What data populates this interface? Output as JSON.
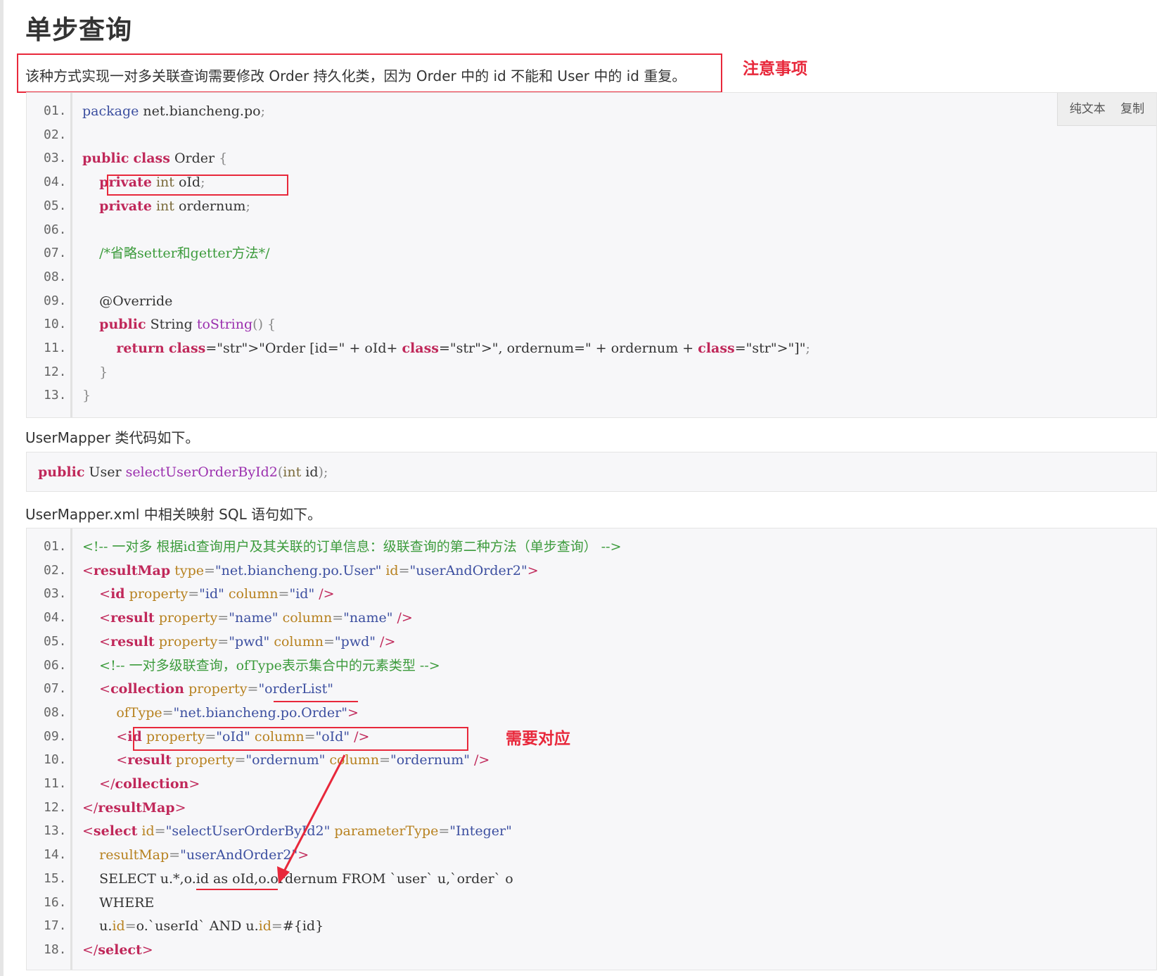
{
  "title": "单步查询",
  "note": {
    "text": "该种方式实现一对多关联查询需要修改 Order 持久化类，因为 Order 中的 id 不能和 User 中的 id 重复。",
    "label": "注意事项"
  },
  "toolbar": {
    "plain_text": "纯文本",
    "copy": "复制"
  },
  "code1": {
    "lines": [
      {
        "n": "01.",
        "t": "package net.biancheng.po;"
      },
      {
        "n": "02.",
        "t": ""
      },
      {
        "n": "03.",
        "t": "public class Order {"
      },
      {
        "n": "04.",
        "t": "    private int oId;"
      },
      {
        "n": "05.",
        "t": "    private int ordernum;"
      },
      {
        "n": "06.",
        "t": ""
      },
      {
        "n": "07.",
        "t": "    /*省略setter和getter方法*/"
      },
      {
        "n": "08.",
        "t": ""
      },
      {
        "n": "09.",
        "t": "    @Override"
      },
      {
        "n": "10.",
        "t": "    public String toString() {"
      },
      {
        "n": "11.",
        "t": "        return \"Order [id=\" + oId+ \", ordernum=\" + ordernum + \"]\";"
      },
      {
        "n": "12.",
        "t": "    }"
      },
      {
        "n": "13.",
        "t": "}"
      }
    ]
  },
  "para1": "UserMapper 类代码如下。",
  "code2": {
    "line": "public User selectUserOrderById2(int id);"
  },
  "para2": "UserMapper.xml 中相关映射 SQL 语句如下。",
  "code3": {
    "lines": [
      {
        "n": "01.",
        "t": "<!-- 一对多 根据id查询用户及其关联的订单信息：级联查询的第二种方法（单步查询） -->"
      },
      {
        "n": "02.",
        "t": "<resultMap type=\"net.biancheng.po.User\" id=\"userAndOrder2\">"
      },
      {
        "n": "03.",
        "t": "    <id property=\"id\" column=\"id\" />"
      },
      {
        "n": "04.",
        "t": "    <result property=\"name\" column=\"name\" />"
      },
      {
        "n": "05.",
        "t": "    <result property=\"pwd\" column=\"pwd\" />"
      },
      {
        "n": "06.",
        "t": "    <!-- 一对多级联查询，ofType表示集合中的元素类型 -->"
      },
      {
        "n": "07.",
        "t": "    <collection property=\"orderList\""
      },
      {
        "n": "08.",
        "t": "        ofType=\"net.biancheng.po.Order\">"
      },
      {
        "n": "09.",
        "t": "        <id property=\"oId\" column=\"oId\" />"
      },
      {
        "n": "10.",
        "t": "        <result property=\"ordernum\" column=\"ordernum\" />"
      },
      {
        "n": "11.",
        "t": "    </collection>"
      },
      {
        "n": "12.",
        "t": "</resultMap>"
      },
      {
        "n": "13.",
        "t": "<select id=\"selectUserOrderById2\" parameterType=\"Integer\""
      },
      {
        "n": "14.",
        "t": "    resultMap=\"userAndOrder2\">"
      },
      {
        "n": "15.",
        "t": "    SELECT u.*,o.id as oId,o.ordernum FROM `user` u,`order` o"
      },
      {
        "n": "16.",
        "t": "    WHERE"
      },
      {
        "n": "17.",
        "t": "    u.id=o.`userId` AND u.id=#{id}"
      },
      {
        "n": "18.",
        "t": "</select>"
      }
    ]
  },
  "annotation_label": "需要对应",
  "colors": {
    "annotation_red": "#e8283b",
    "code_bg": "#f7f7f9"
  }
}
